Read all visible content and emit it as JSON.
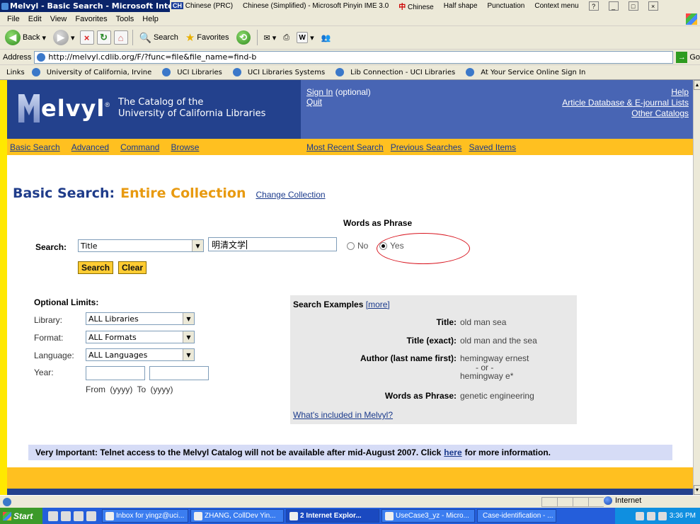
{
  "window": {
    "title": "Melvyl - Basic Search - Microsoft Internet Explorer",
    "ime": {
      "lang_code": "CH",
      "lang": "Chinese (PRC)",
      "ime_name": "Chinese (Simplified) - Microsoft Pinyin IME 3.0",
      "mode_char": "中",
      "mode": "Chinese",
      "shape": "Half shape",
      "punct": "Punctuation",
      "context": "Context menu"
    }
  },
  "menu": [
    "File",
    "Edit",
    "View",
    "Favorites",
    "Tools",
    "Help"
  ],
  "toolbar": {
    "back": "Back",
    "search": "Search",
    "favorites": "Favorites"
  },
  "address": {
    "label": "Address",
    "url": "http://melvyl.cdlib.org/F/?func=file&file_name=find-b",
    "go": "Go"
  },
  "links": {
    "label": "Links",
    "items": [
      "University of California, Irvine",
      "UCI Libraries",
      "UCI Libraries Systems",
      "Lib Connection - UCI Libraries",
      "At Your Service Online Sign In"
    ]
  },
  "banner": {
    "logo_word": "elvyl",
    "reg": "®",
    "tagline_1": "The Catalog of the",
    "tagline_2": "University of California Libraries",
    "signin": "Sign In",
    "optional": " (optional)",
    "quit": "Quit",
    "help": "Help",
    "article_db": "Article Database & E-journal Lists",
    "other_catalogs": "Other Catalogs"
  },
  "nav": {
    "left": [
      "Basic Search",
      "Advanced",
      "Command",
      "Browse"
    ],
    "right": [
      "Most Recent Search",
      "Previous Searches",
      "Saved Items"
    ]
  },
  "heading": {
    "part1": "Basic Search:",
    "part2": "Entire Collection",
    "change": "Change Collection"
  },
  "search": {
    "words_as_phrase": "Words as Phrase",
    "label": "Search:",
    "field": "Title",
    "term": "明清文学",
    "no": "No",
    "yes": "Yes",
    "yes_selected": true,
    "search_btn": "Search",
    "clear_btn": "Clear"
  },
  "limits": {
    "title": "Optional Limits:",
    "library_label": "Library:",
    "library_value": "ALL Libraries",
    "format_label": "Format:",
    "format_value": "ALL Formats",
    "language_label": "Language:",
    "language_value": "ALL Languages",
    "year_label": "Year:",
    "year_hint": "From (yyyy)  To (yyyy)"
  },
  "examples": {
    "title": "Search Examples",
    "more": "[more]",
    "rows": [
      {
        "k": "Title:",
        "v": "old man sea"
      },
      {
        "k": "Title (exact):",
        "v": "old man and the sea"
      },
      {
        "k": "Author (last name first):",
        "v": "hemingway ernest"
      },
      {
        "k": "",
        "v": "- or -"
      },
      {
        "k": "",
        "v": "hemingway e*"
      },
      {
        "k": "Words as Phrase:",
        "v": "genetic engineering"
      }
    ],
    "included": "What's included in Melvyl?"
  },
  "notice": {
    "text_before": "Very Important: Telnet access to the Melvyl Catalog will not be available after mid-August 2007. Click",
    "link": "here",
    "text_after": "for more information."
  },
  "status": {
    "zone": "Internet"
  },
  "taskbar": {
    "start": "Start",
    "tasks": [
      "Inbox for yingz@uci...",
      "ZHANG, CollDev Yin...",
      "2 Internet Explor...",
      "UseCase3_yz - Micro...",
      "Case-identification - ..."
    ],
    "clock": "3:36 PM"
  }
}
